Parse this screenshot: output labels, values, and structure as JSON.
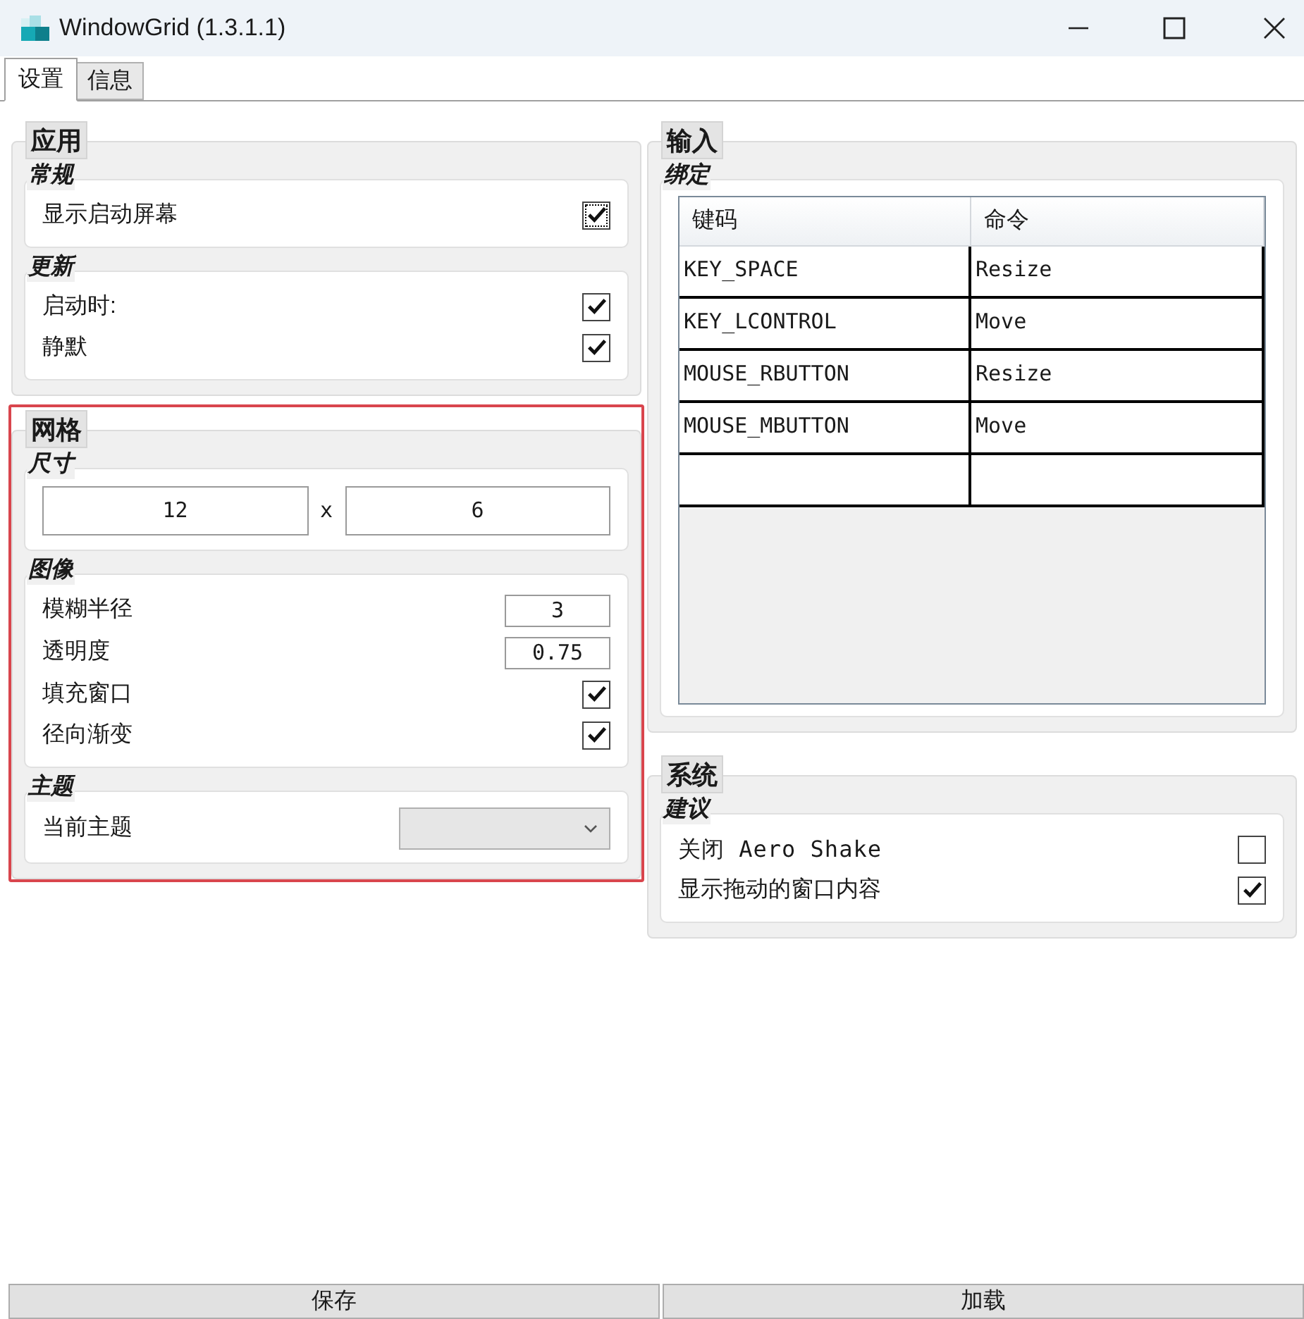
{
  "window": {
    "title": "WindowGrid (1.3.1.1)"
  },
  "tabs": [
    {
      "label": "设置",
      "selected": true
    },
    {
      "label": "信息",
      "selected": false
    }
  ],
  "left_column": {
    "sections": [
      {
        "title": "应用",
        "highlighted": false,
        "groups": [
          {
            "title": "常规",
            "items": [
              {
                "kind": "checkbox",
                "label": "显示启动屏幕",
                "checked": true,
                "focused": true
              }
            ]
          },
          {
            "title": "更新",
            "items": [
              {
                "kind": "checkbox",
                "label": "启动时:",
                "checked": true,
                "focused": false
              },
              {
                "kind": "checkbox",
                "label": "静默",
                "checked": true,
                "focused": false
              }
            ]
          }
        ]
      },
      {
        "title": "网格",
        "highlighted": true,
        "groups": [
          {
            "title": "尺寸",
            "items": [
              {
                "kind": "size",
                "values": [
                  "12",
                  "6"
                ],
                "separator": "x"
              }
            ]
          },
          {
            "title": "图像",
            "items": [
              {
                "kind": "number",
                "label": "模糊半径",
                "value": "3"
              },
              {
                "kind": "number",
                "label": "透明度",
                "value": "0.75"
              },
              {
                "kind": "checkbox",
                "label": "填充窗口",
                "checked": true,
                "focused": false
              },
              {
                "kind": "checkbox",
                "label": "径向渐变",
                "checked": true,
                "focused": false
              }
            ]
          },
          {
            "title": "主题",
            "items": [
              {
                "kind": "dropdown",
                "label": "当前主题"
              }
            ]
          }
        ]
      }
    ]
  },
  "right_column": {
    "sections": [
      {
        "title": "输入",
        "highlighted": false,
        "groups": [
          {
            "title": "绑定",
            "items": [
              {
                "kind": "table",
                "columns": [
                  "键码",
                  "命令"
                ],
                "new_row": true,
                "rows": [
                  [
                    "KEY_SPACE",
                    "Resize"
                  ],
                  [
                    "KEY_LCONTROL",
                    "Move"
                  ],
                  [
                    "MOUSE_RBUTTON",
                    "Resize"
                  ],
                  [
                    "MOUSE_MBUTTON",
                    "Move"
                  ]
                ]
              }
            ]
          }
        ]
      },
      {
        "title": "系统",
        "highlighted": false,
        "groups": [
          {
            "title": "建议",
            "items": [
              {
                "kind": "checkbox",
                "label": "关闭 Aero Shake",
                "checked": false,
                "focused": false,
                "mono": true
              },
              {
                "kind": "checkbox",
                "label": "显示拖动的窗口内容",
                "checked": true,
                "focused": false,
                "mono": false
              }
            ]
          }
        ]
      }
    ]
  },
  "buttons": [
    "保存",
    "加载"
  ]
}
